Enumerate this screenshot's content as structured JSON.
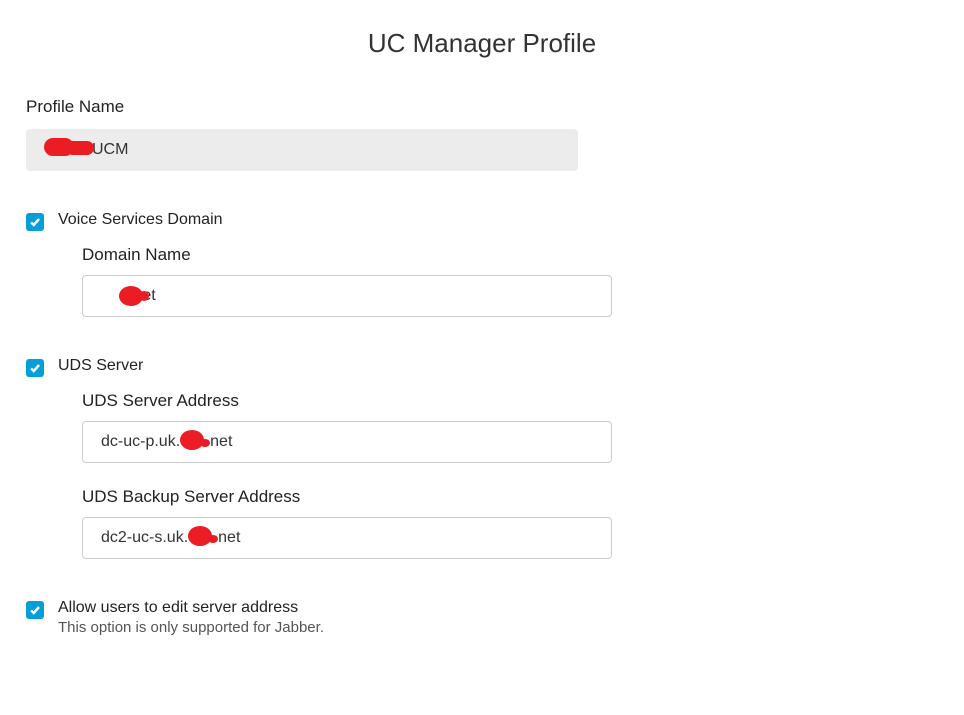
{
  "title": "UC Manager Profile",
  "profile": {
    "label": "Profile Name",
    "value_suffix": "UCM"
  },
  "voice": {
    "checkbox_label": "Voice Services Domain",
    "checked": true,
    "domain_label": "Domain Name",
    "domain_value_suffix": ".net"
  },
  "uds": {
    "checkbox_label": "UDS Server",
    "checked": true,
    "server_label": "UDS Server Address",
    "server_prefix": "dc-uc-p.uk.",
    "server_suffix": "net",
    "backup_label": "UDS Backup Server Address",
    "backup_prefix": "dc2-uc-s.uk.",
    "backup_suffix": "net"
  },
  "allow_edit": {
    "checked": true,
    "label": "Allow users to edit server address",
    "sub": "This option is only supported for Jabber."
  }
}
